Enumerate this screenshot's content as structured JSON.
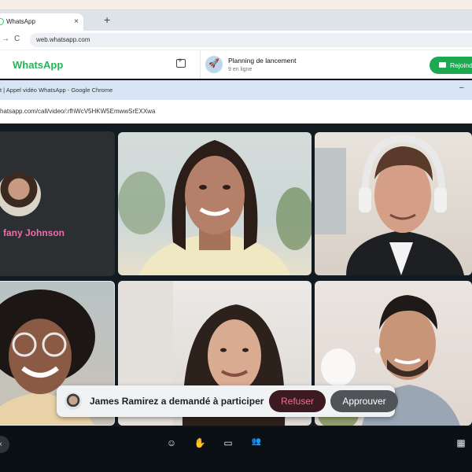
{
  "back_window": {
    "tab_title": "WhatsApp",
    "tab_close": "×",
    "new_tab": "+",
    "nav_back": "→",
    "nav_reload": "C",
    "url": "web.whatsapp.com",
    "app_name": "WhatsApp",
    "chat": {
      "name": "Planning de lancement",
      "status": "9 en ligne",
      "join_label": "Rejoindre"
    }
  },
  "call_window": {
    "title": "t | Appel vidéo WhatsApp - Google Chrome",
    "minimize": "–",
    "url": "hatsapp.com/call/video/:rfhWcV5HKW5EmwwSrEXXwa",
    "profile_tile_name": "fany Johnson",
    "tiles": [
      {
        "name": "participant-1"
      },
      {
        "name": "participant-2"
      },
      {
        "name": "participant-3"
      },
      {
        "name": "participant-4"
      },
      {
        "name": "participant-5"
      }
    ]
  },
  "toast": {
    "message": "James Ramirez a demandé à participer",
    "refuse_label": "Refuser",
    "approve_label": "Approuver"
  },
  "controls": {
    "left_glyph": "‹",
    "emoji": "☺",
    "hand": "✋",
    "screen": "▭",
    "people": "👥",
    "calendar": "▦"
  },
  "colors": {
    "accent_green": "#25b35a",
    "profile_name": "#ef6ca8",
    "refuse_text": "#f06d91",
    "call_background": "#111b21"
  }
}
